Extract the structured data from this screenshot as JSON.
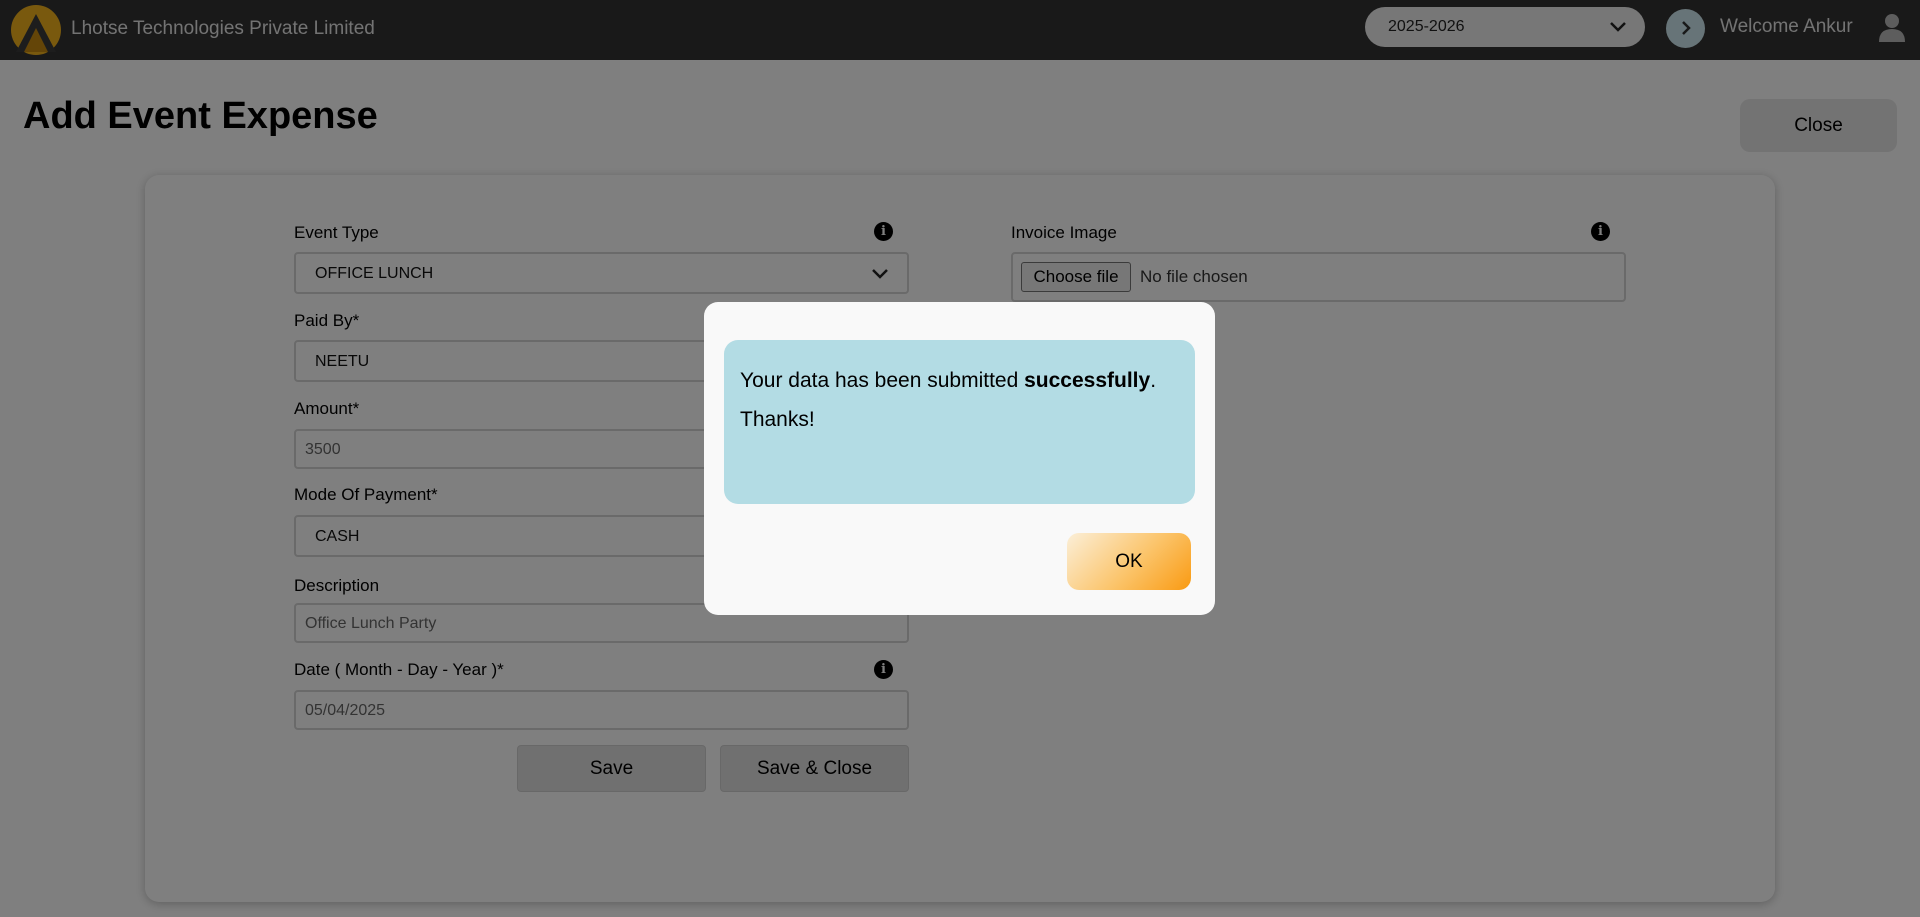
{
  "header": {
    "company_name": "Lhotse Technologies Private Limited",
    "financial_year": "2025-2026",
    "welcome_text": "Welcome Ankur"
  },
  "page": {
    "title": "Add Event Expense",
    "close_label": "Close"
  },
  "form": {
    "event_type": {
      "label": "Event Type",
      "value": "OFFICE LUNCH"
    },
    "paid_by": {
      "label": "Paid By",
      "required_mark": "*",
      "value": "NEETU"
    },
    "amount": {
      "label": "Amount",
      "required_mark": "*",
      "value": "3500"
    },
    "mode_of_payment": {
      "label": "Mode Of Payment",
      "required_mark": "*",
      "value": "CASH"
    },
    "description": {
      "label": "Description",
      "value": "Office Lunch Party"
    },
    "date": {
      "label": "Date ( Month - Day - Year )",
      "required_mark": "*",
      "value": "05/04/2025"
    },
    "invoice_image": {
      "label": "Invoice Image",
      "button_label": "Choose file",
      "status": "No file chosen"
    },
    "save_label": "Save",
    "save_close_label": "Save & Close"
  },
  "modal": {
    "message_prefix": "Your data has been submitted ",
    "message_bold": "successfully",
    "message_suffix": ".",
    "thanks": "Thanks!",
    "ok_label": "OK"
  },
  "colors": {
    "topbar": "#333333",
    "alert_bg": "#b3dce4",
    "ok_gradient_end": "#f99a12"
  }
}
